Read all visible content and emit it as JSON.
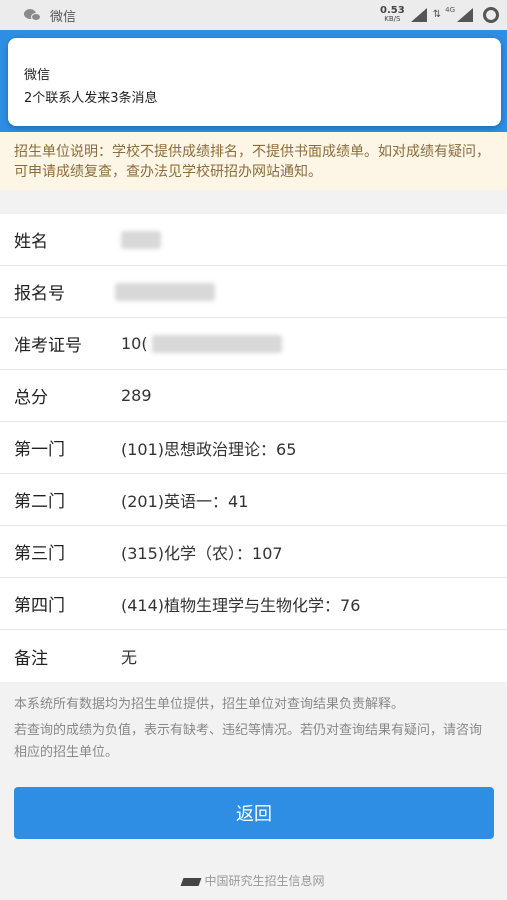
{
  "status_bar": {
    "app_label": "微信",
    "net_speed": "0.53",
    "net_unit": "KB/S",
    "network_tag": "4G"
  },
  "notification": {
    "title": "微信",
    "body": "2个联系人发来3条消息"
  },
  "notice": "招生单位说明：学校不提供成绩排名，不提供书面成绩单。如对成绩有疑问，可申请成绩复查，查办法见学校研招办网站通知。",
  "fields": [
    {
      "label": "姓名",
      "value": ""
    },
    {
      "label": "报名号",
      "value": ""
    },
    {
      "label": "准考证号",
      "value": "10("
    },
    {
      "label": "总分",
      "value": "289"
    },
    {
      "label": "第一门",
      "value": "(101)思想政治理论：65"
    },
    {
      "label": "第二门",
      "value": "(201)英语一：41"
    },
    {
      "label": "第三门",
      "value": "(315)化学（农）：107"
    },
    {
      "label": "第四门",
      "value": "(414)植物生理学与生物化学：76"
    },
    {
      "label": "备注",
      "value": "无"
    }
  ],
  "footer_notes": [
    "本系统所有数据均为招生单位提供，招生单位对查询结果负责解释。",
    "若查询的成绩为负值，表示有缺考、违纪等情况。若仍对查询结果有疑问，请咨询相应的招生单位。"
  ],
  "back_button": "返回",
  "brand": "中国研究生招生信息网",
  "colors": {
    "primary": "#2d8ee3",
    "notice_bg": "#fdf6e6",
    "notice_text": "#8a6d3b"
  }
}
